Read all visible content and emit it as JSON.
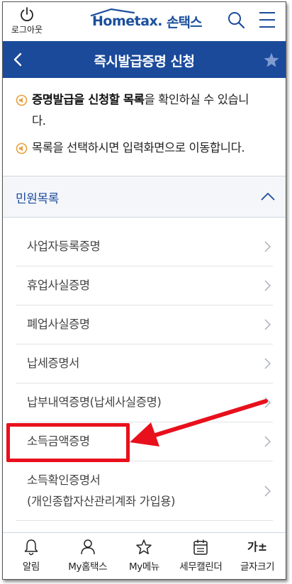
{
  "topbar": {
    "logout_label": "로그아웃",
    "brand_en": "Hometax.",
    "brand_ko": "손택스"
  },
  "titlebar": {
    "title": "즉시발급증명 신청"
  },
  "notices": [
    {
      "bold1": "증명발급을 신청할 목록",
      "text1": "을 확인하실 수 있습니",
      "text2": "다."
    },
    {
      "text": "목록을 선택하시면 입력화면으로 이동합니다."
    }
  ],
  "section": {
    "title": "민원목록"
  },
  "list": [
    {
      "label": "사업자등록증명"
    },
    {
      "label": "휴업사실증명"
    },
    {
      "label": "폐업사실증명"
    },
    {
      "label": "납세증명서"
    },
    {
      "label": "납부내역증명(납세사실증명)"
    },
    {
      "label": "소득금액증명"
    },
    {
      "label": "소득확인증명서",
      "label2": "(개인종합자산관리계좌 가입용)"
    }
  ],
  "bottomnav": {
    "items": [
      {
        "label": "알림",
        "icon": "bell-icon"
      },
      {
        "label": "My홈택스",
        "icon": "person-icon"
      },
      {
        "label": "My메뉴",
        "icon": "star-icon"
      },
      {
        "label": "세무캘린더",
        "icon": "calendar-icon"
      },
      {
        "label": "글자크기",
        "icon": "font-size-icon",
        "glyph": "가±"
      }
    ]
  },
  "colors": {
    "brand_blue": "#1b4a9b",
    "highlight_red": "#e8101c",
    "bullet_orange": "#e9a13b"
  }
}
